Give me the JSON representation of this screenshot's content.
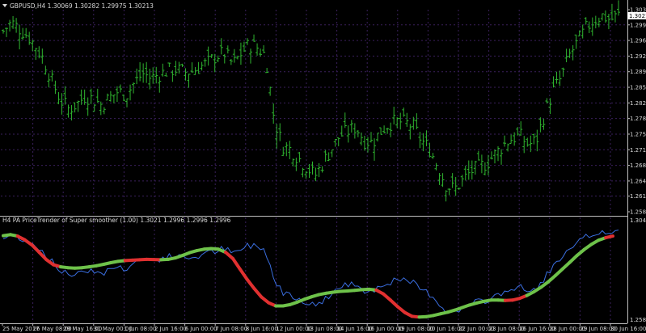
{
  "main_panel": {
    "header": "GBPUSD,H4  1.30069 1.30282 1.29975 1.30213",
    "current_price_label": "1.30213",
    "price_labels": [
      "1.30330",
      "1.29990",
      "1.29640",
      "1.29290",
      "1.28940",
      "1.28590",
      "1.28240",
      "1.27890",
      "1.27540",
      "1.27190",
      "1.26840",
      "1.26490",
      "1.26150",
      "1.25800"
    ]
  },
  "indicator_panel": {
    "header": "H4  PA PriceTrender of Super smoother (1.00) 1.3021 1.2996 1.2996 1.2996",
    "price_top": "1.3045",
    "price_bottom": "1.2586"
  },
  "time_labels": [
    "25 May 2017",
    "26 May 08:00",
    "29 May 16:00",
    "31 May 00:00",
    "1 Jun 08:00",
    "2 Jun 16:00",
    "6 Jun 00:00",
    "7 Jun 08:00",
    "8 Jun 16:00",
    "12 Jun 00:00",
    "13 Jun 08:00",
    "14 Jun 16:00",
    "16 Jun 00:00",
    "19 Jun 08:00",
    "20 Jun 16:00",
    "22 Jun 00:00",
    "23 Jun 08:00",
    "26 Jun 16:00",
    "28 Jun 00:00",
    "29 Jun 08:00",
    "30 Jun 16:00"
  ],
  "colors": {
    "background": "#000000",
    "grid": "#3a1f5c",
    "bars": "#2fb52f",
    "axis_text": "#d8d8d8",
    "price_line": "#3a6ee0",
    "trend_up": "#6ec24a",
    "trend_down": "#e03030"
  },
  "chart_data": {
    "type": "bar",
    "symbol": "GBPUSD",
    "timeframe": "H4",
    "ylim": [
      1.258,
      1.3033
    ],
    "close_path": [
      1.2985,
      1.3005,
      1.299,
      1.2975,
      1.295,
      1.2918,
      1.287,
      1.283,
      1.281,
      1.2822,
      1.284,
      1.2832,
      1.282,
      1.2836,
      1.285,
      1.2842,
      1.287,
      1.289,
      1.288,
      1.2888,
      1.2896,
      1.29,
      1.2893,
      1.2895,
      1.2905,
      1.2915,
      1.293,
      1.2936,
      1.291,
      1.2935,
      1.2955,
      1.2948,
      1.293,
      1.279,
      1.273,
      1.272,
      1.27,
      1.268,
      1.266,
      1.269,
      1.272,
      1.275,
      1.276,
      1.277,
      1.274,
      1.2735,
      1.276,
      1.2778,
      1.2782,
      1.278,
      1.277,
      1.274,
      1.272,
      1.268,
      1.264,
      1.263,
      1.265,
      1.267,
      1.268,
      1.269,
      1.271,
      1.273,
      1.2745,
      1.275,
      1.273,
      1.274,
      1.28,
      1.285,
      1.288,
      1.293,
      1.296,
      1.299,
      1.301,
      1.302,
      1.301,
      1.3021
    ],
    "indicator": {
      "name": "PA PriceTrender of Super smoother (1.00)",
      "values": [
        1.3021,
        1.2996,
        1.2996,
        1.2996
      ],
      "ylim": [
        1.2586,
        1.3045
      ],
      "line": [
        1.3,
        1.3005,
        1.2998,
        1.298,
        1.2955,
        1.292,
        1.2885,
        1.286,
        1.285,
        1.2846,
        1.2844,
        1.2846,
        1.285,
        1.2855,
        1.2862,
        1.287,
        1.2876,
        1.288,
        1.2882,
        1.2884,
        1.2886,
        1.2885,
        1.2884,
        1.2886,
        1.2893,
        1.2905,
        1.2918,
        1.2928,
        1.2935,
        1.2938,
        1.2935,
        1.292,
        1.289,
        1.284,
        1.279,
        1.2745,
        1.2705,
        1.2677,
        1.2662,
        1.2662,
        1.2668,
        1.268,
        1.2694,
        1.2706,
        1.2716,
        1.2723,
        1.2728,
        1.2732,
        1.2734,
        1.2737,
        1.274,
        1.2742,
        1.2738,
        1.272,
        1.269,
        1.2658,
        1.263,
        1.2612,
        1.2608,
        1.261,
        1.2616,
        1.2624,
        1.2632,
        1.2642,
        1.2654,
        1.2666,
        1.2676,
        1.2684,
        1.269,
        1.269,
        1.2688,
        1.269,
        1.2698,
        1.2712,
        1.273,
        1.2752,
        1.2778,
        1.2808,
        1.284,
        1.2872,
        1.2904,
        1.2933,
        1.2958,
        1.2978,
        1.299,
        1.2998
      ],
      "down_segments": [
        [
          2,
          8
        ],
        [
          17,
          22
        ],
        [
          31,
          38
        ],
        [
          52,
          58
        ],
        [
          70,
          73
        ],
        [
          84,
          86
        ]
      ]
    }
  }
}
